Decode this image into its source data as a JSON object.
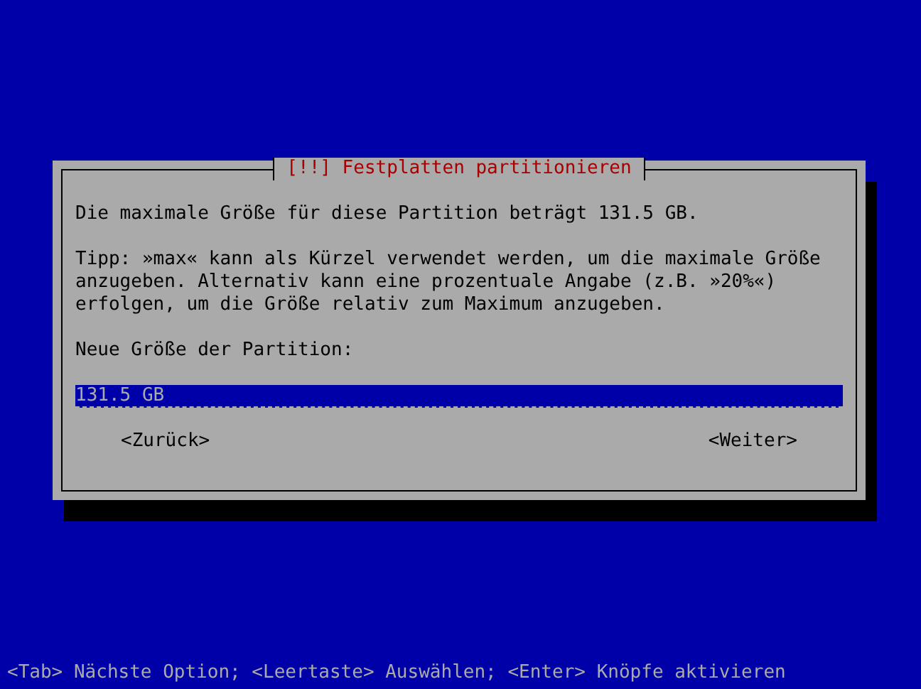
{
  "dialog": {
    "title": "[!!] Festplatten partitionieren",
    "message": "Die maximale Größe für diese Partition beträgt 131.5 GB.",
    "hint": "Tipp: »max« kann als Kürzel verwendet werden, um die maximale Größe anzugeben. Alternativ kann eine prozentuale Angabe (z.B. »20%«) erfolgen, um die Größe relativ zum Maximum anzugeben.",
    "field_label": "Neue Größe der Partition:",
    "field": {
      "value": "131.5 GB"
    },
    "buttons": [
      {
        "label": "<Zurück>",
        "selected": false
      },
      {
        "label": "<Weiter>",
        "selected": false
      }
    ]
  },
  "status_bar": "<Tab> Nächste Option; <Leertaste> Auswählen; <Enter> Knöpfe aktivieren"
}
